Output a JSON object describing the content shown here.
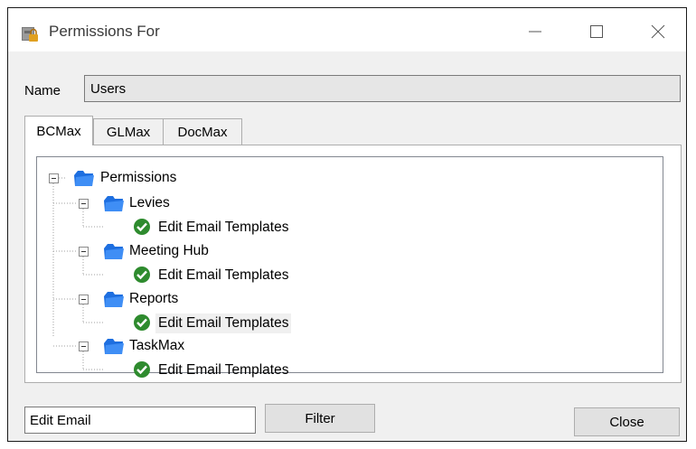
{
  "window": {
    "title": "Permissions For",
    "icon": "lock-icon",
    "controls": [
      "minimize-icon",
      "maximize-icon",
      "close-icon"
    ]
  },
  "name_field": {
    "label": "Name",
    "value": "Users"
  },
  "tabs": [
    {
      "label": "BCMax",
      "active": true
    },
    {
      "label": "GLMax",
      "active": false
    },
    {
      "label": "DocMax",
      "active": false
    }
  ],
  "tree": {
    "root": "Permissions",
    "groups": [
      {
        "label": "Levies",
        "items": [
          "Edit Email Templates"
        ]
      },
      {
        "label": "Meeting Hub",
        "items": [
          "Edit Email Templates"
        ]
      },
      {
        "label": "Reports",
        "items": [
          "Edit Email Templates"
        ],
        "selected_item": 0
      },
      {
        "label": "TaskMax",
        "items": [
          "Edit Email Templates"
        ]
      }
    ],
    "folder_icon": "folder-icon",
    "item_icon": "check-icon"
  },
  "filter": {
    "value": "Edit Email",
    "button_label": "Filter"
  },
  "close_button_label": "Close",
  "colors": {
    "folder": "#1e6fe0",
    "check": "#2e8b2e"
  }
}
